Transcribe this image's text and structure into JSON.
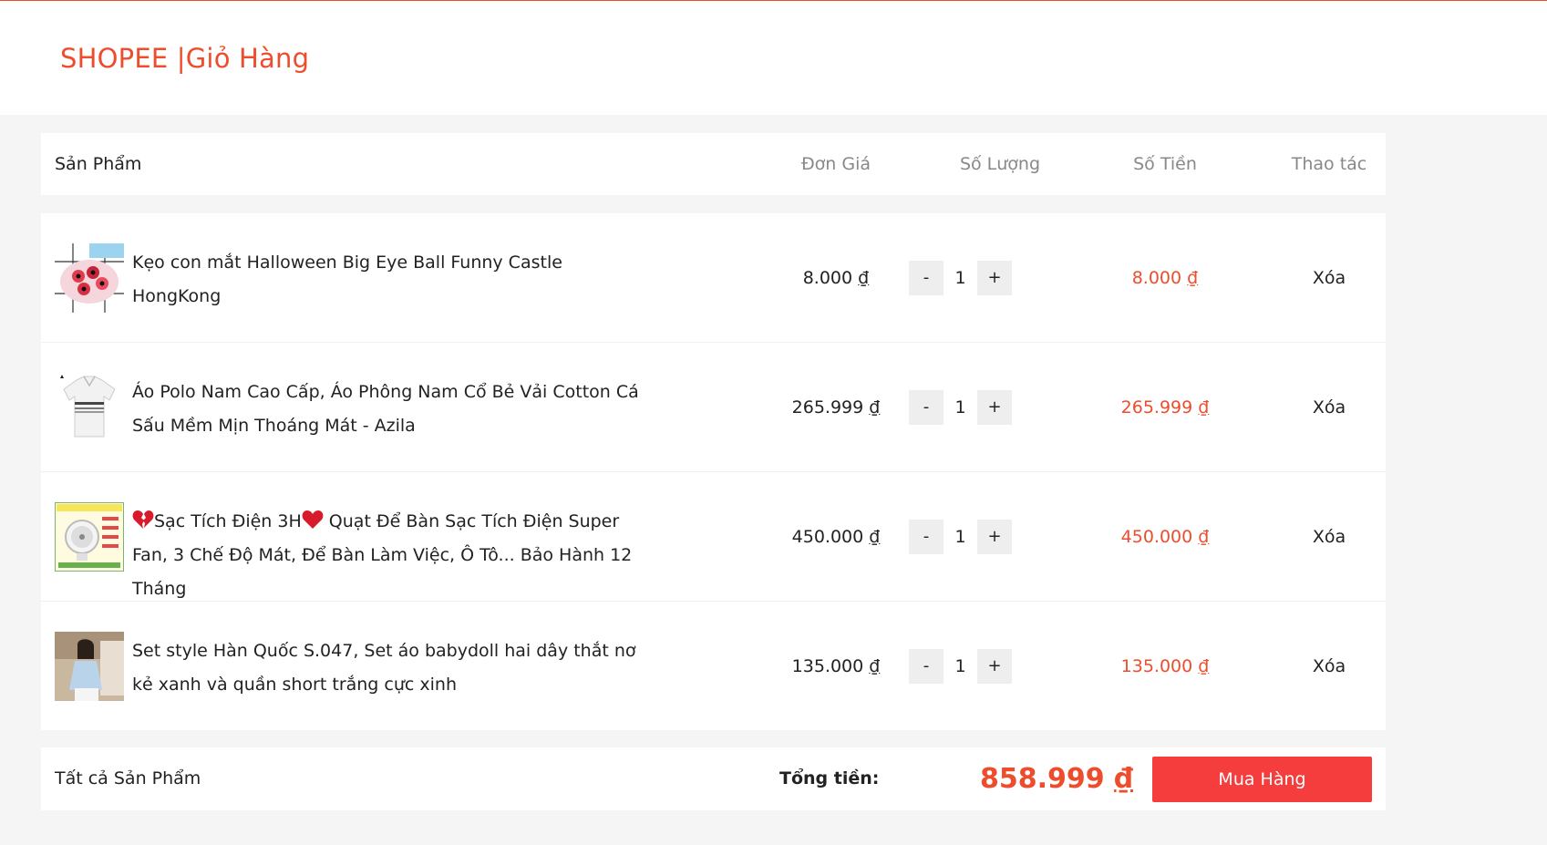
{
  "header": {
    "brand": "SHOPEE |Giỏ Hàng"
  },
  "table_header": {
    "product": "Sản Phẩm",
    "unit_price": "Đơn Giá",
    "quantity": "Số Lượng",
    "total": "Số Tiền",
    "action": "Thao tác"
  },
  "currency": "₫",
  "items": [
    {
      "name": "Kẹo con mắt Halloween Big Eye Ball Funny Castle HongKong",
      "price": "8.000",
      "qty": "1",
      "total": "8.000",
      "action": "Xóa",
      "minus": "-",
      "plus": "+"
    },
    {
      "name": "Áo Polo Nam Cao Cấp, Áo Phông Nam Cổ Bẻ Vải Cotton Cá Sấu Mềm Mịn Thoáng Mát - Azila",
      "price": "265.999",
      "qty": "1",
      "total": "265.999",
      "action": "Xóa",
      "minus": "-",
      "plus": "+"
    },
    {
      "name_a": "Sạc Tích Điện 3H",
      "name_b": " Quạt Để Bàn Sạc Tích Điện Super Fan, 3 Chế Độ Mát, Để Bàn Làm Việc, Ô Tô... Bảo Hành 12 Tháng",
      "price": "450.000",
      "qty": "1",
      "total": "450.000",
      "action": "Xóa",
      "minus": "-",
      "plus": "+"
    },
    {
      "name": "Set style Hàn Quốc S.047, Set áo babydoll hai dây thắt nơ kẻ xanh và quần short trắng cực xinh",
      "price": "135.000",
      "qty": "1",
      "total": "135.000",
      "action": "Xóa",
      "minus": "-",
      "plus": "+"
    }
  ],
  "footer": {
    "all_products": "Tất cả Sản Phẩm",
    "sum_label": "Tổng tiền:",
    "sum_value": "858.999",
    "buy_label": "Mua Hàng"
  },
  "colors": {
    "brand": "#ee4d2d",
    "buy_button": "#f53d3d"
  }
}
